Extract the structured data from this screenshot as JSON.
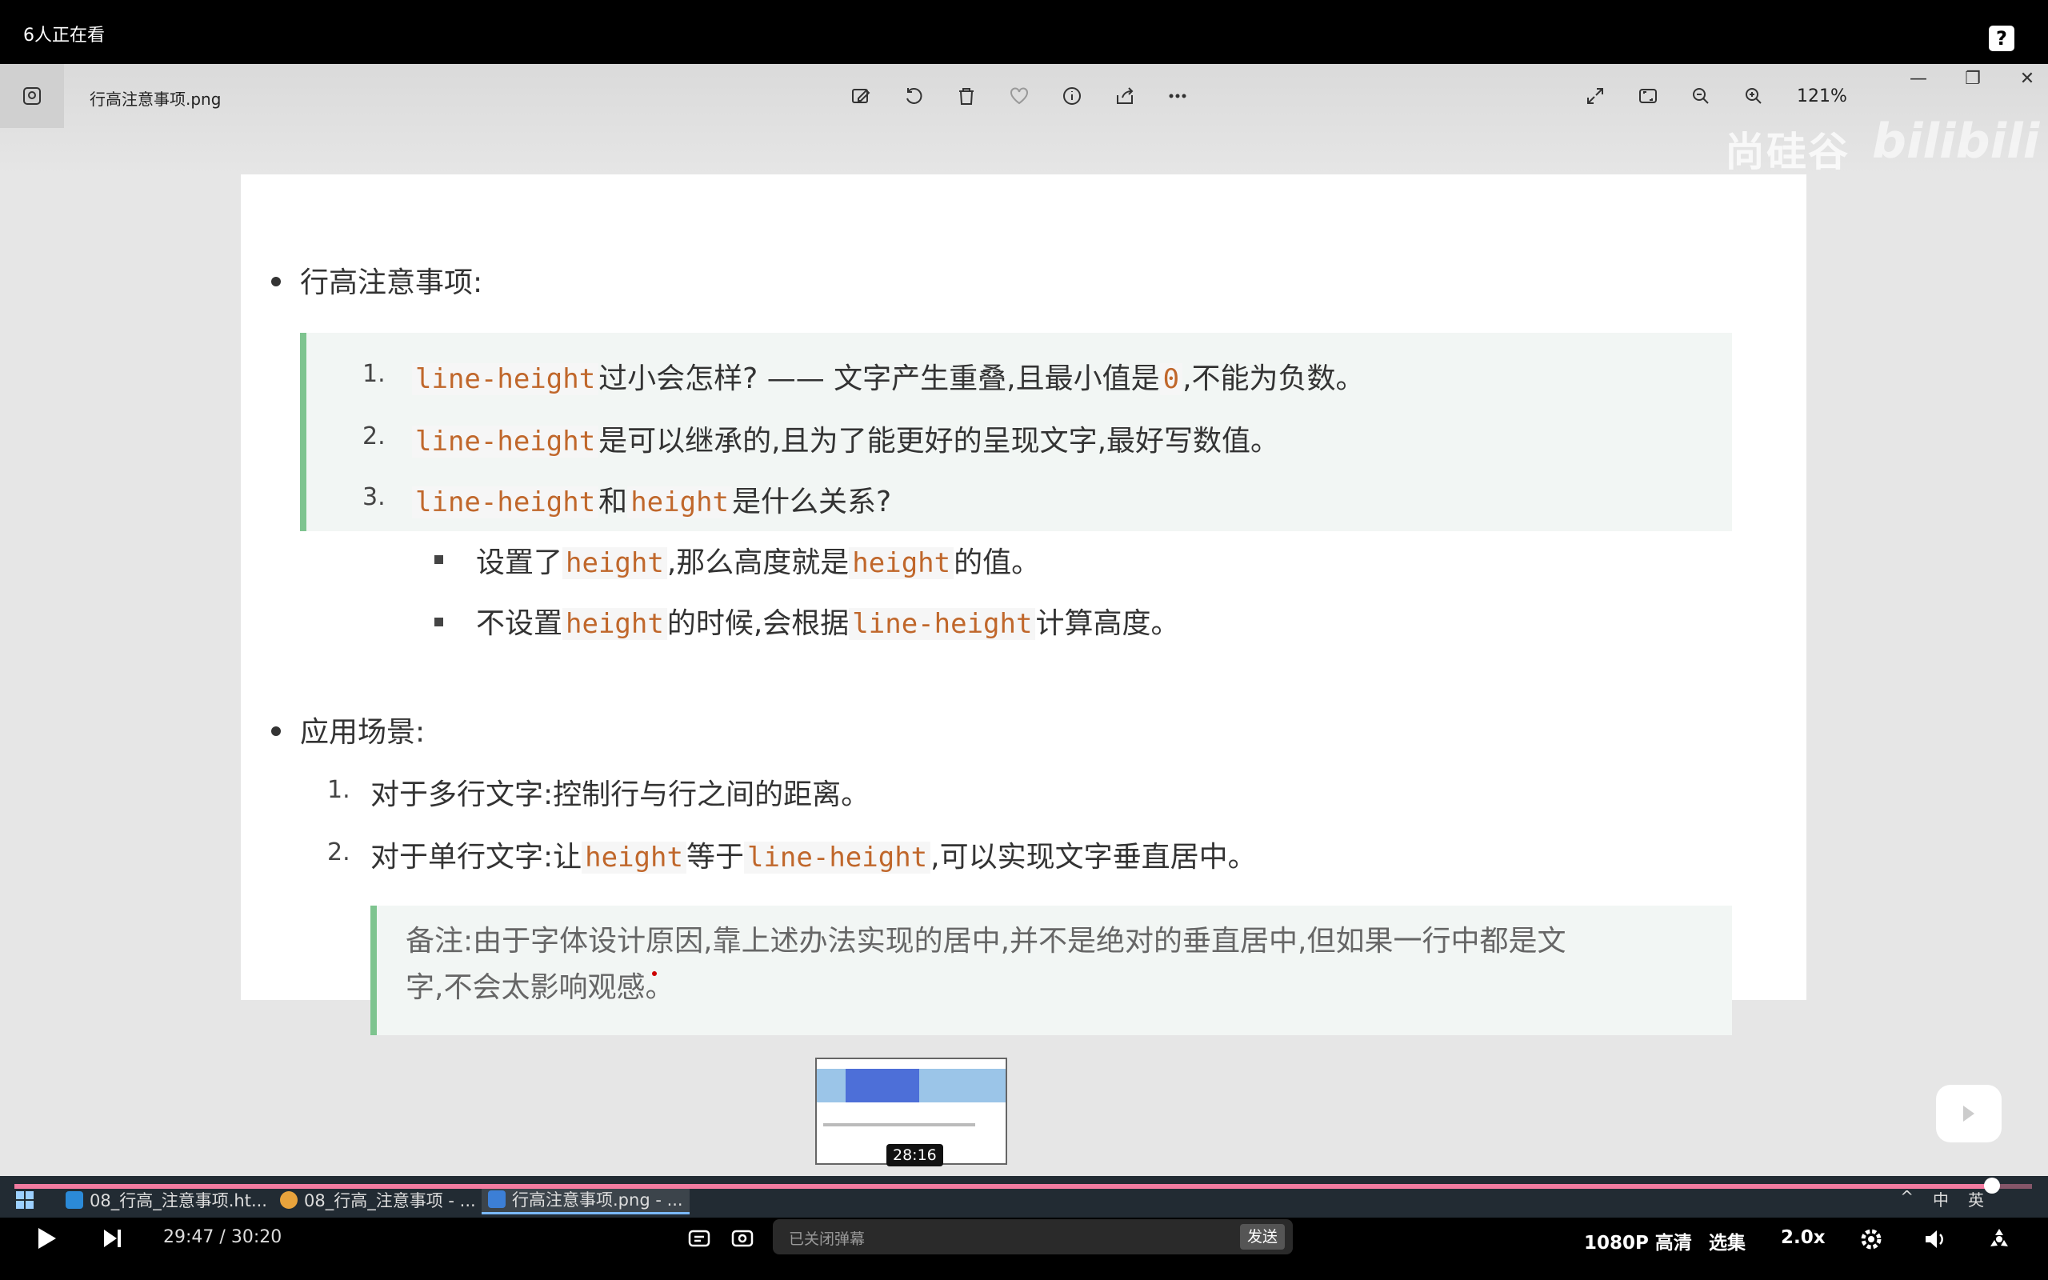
{
  "top": {
    "viewer_count": "6人正在看",
    "help": "?"
  },
  "viewer": {
    "file_name": "行高注意事项.png",
    "zoom": "121%",
    "watermark_text": "尚硅谷",
    "watermark_logo": "bilibili"
  },
  "doc": {
    "heading1": "行高注意事项:",
    "items": [
      {
        "num": "1.",
        "code1": "line-height",
        "text1": "过小会怎样? —— 文字产生重叠,且最小值是",
        "code2": "0",
        "text2": ",不能为负数。"
      },
      {
        "num": "2.",
        "code1": "line-height",
        "text1": "是可以继承的,且为了能更好的呈现文字,最好写数值。"
      },
      {
        "num": "3.",
        "code1": "line-height",
        "text1": "和",
        "code2": "height",
        "text2": "是什么关系?"
      }
    ],
    "subitems": [
      {
        "t1": "设置了",
        "c1": "height",
        "t2": ",那么高度就是",
        "c2": "height",
        "t3": "的值。"
      },
      {
        "t1": "不设置",
        "c1": "height",
        "t2": "的时候,会根据",
        "c2": "line-height",
        "t3": "计算高度。"
      }
    ],
    "heading2": "应用场景:",
    "scenes": [
      {
        "num": "1.",
        "text": "对于多行文字:控制行与行之间的距离。"
      },
      {
        "num": "2.",
        "t1": "对于单行文字:让",
        "c1": "height",
        "t2": "等于",
        "c2": "line-height",
        "t3": ",可以实现文字垂直居中。"
      }
    ],
    "note_line1": "备注:由于字体设计原因,靠上述办法实现的居中,并不是绝对的垂直居中,但如果一行中都是文",
    "note_line2": "字,不会太影响观感。"
  },
  "preview": {
    "time": "28:16"
  },
  "progress": {
    "played_fraction": 0.98
  },
  "taskbar": {
    "items": [
      {
        "label": "08_行高_注意事项.ht..."
      },
      {
        "label": "08_行高_注意事项 - ..."
      },
      {
        "label": "行高注意事项.png - ..."
      }
    ],
    "ime": "中",
    "lang": "英"
  },
  "player": {
    "current_time": "29:47",
    "separator": "/",
    "total_time": "30:20",
    "danmaku_placeholder": "已关闭弹幕",
    "send": "发送",
    "quality": "1080P 高清",
    "episodes": "选集",
    "speed": "2.0x"
  }
}
